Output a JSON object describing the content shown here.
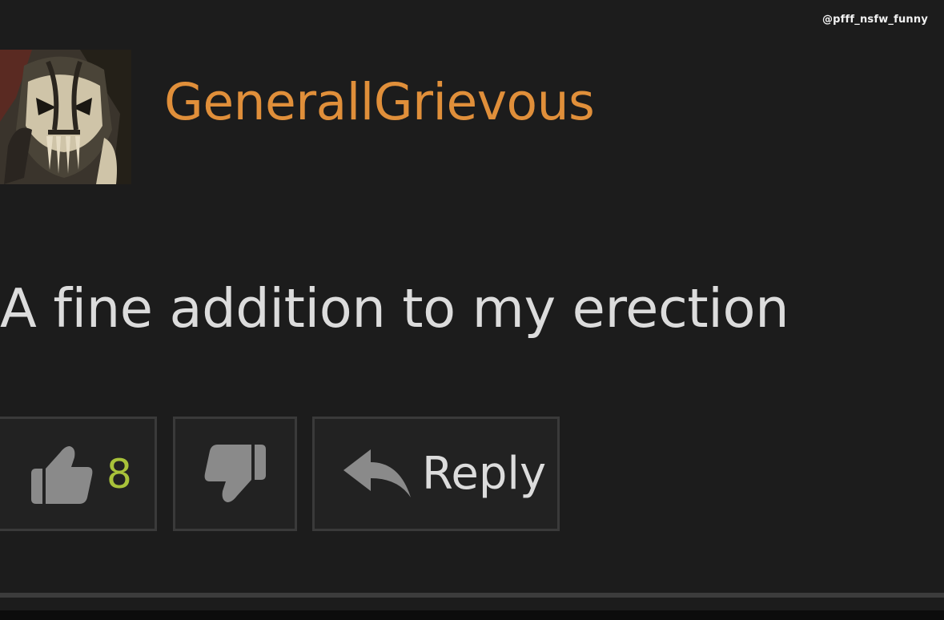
{
  "watermark": "@pfff_nsfw_funny",
  "comment": {
    "username": "GenerallGrievous",
    "username_color": "#e08f3a",
    "text": "A fine addition to my erection"
  },
  "actions": {
    "like_icon": "thumbs-up-icon",
    "like_count": "8",
    "dislike_icon": "thumbs-down-icon",
    "reply_icon": "reply-arrow-icon",
    "reply_label": "Reply"
  }
}
